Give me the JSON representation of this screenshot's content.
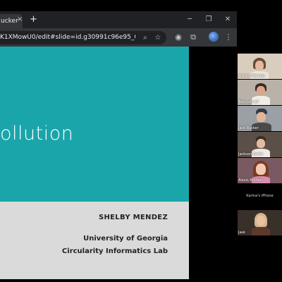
{
  "browser": {
    "tab_title": "ucker",
    "tab_close": "×",
    "new_tab": "+",
    "window_controls": {
      "minimize": "─",
      "restore": "❐",
      "close": "✕"
    },
    "url": "K1XMowU0/edit#slide=id.g30991c96e95_0_468",
    "icons": {
      "zoom": "search-icon",
      "bookmark": "star-icon",
      "extension_a": "extension-icon",
      "extensions": "puzzle-icon",
      "profile": "avatar",
      "menu": "kebab-menu-icon"
    }
  },
  "slide": {
    "title": "ollution",
    "presenter": "SHELBY MENDEZ",
    "org_line1": "University of Georgia",
    "org_line2": "Circularity Informatics Lab",
    "colors": {
      "top": "#1aa5ab",
      "bottom": "#dadada",
      "text_dark": "#222222"
    }
  },
  "participants": [
    {
      "name": "Shelby Mendez"
    },
    {
      "name": "Toni Lohroff"
    },
    {
      "name": "Jack Rucker"
    },
    {
      "name": "Jackson Berlin"
    },
    {
      "name": "Alexis Rothen"
    },
    {
      "name": "Karina's iPhone"
    },
    {
      "name": "Jask"
    }
  ]
}
